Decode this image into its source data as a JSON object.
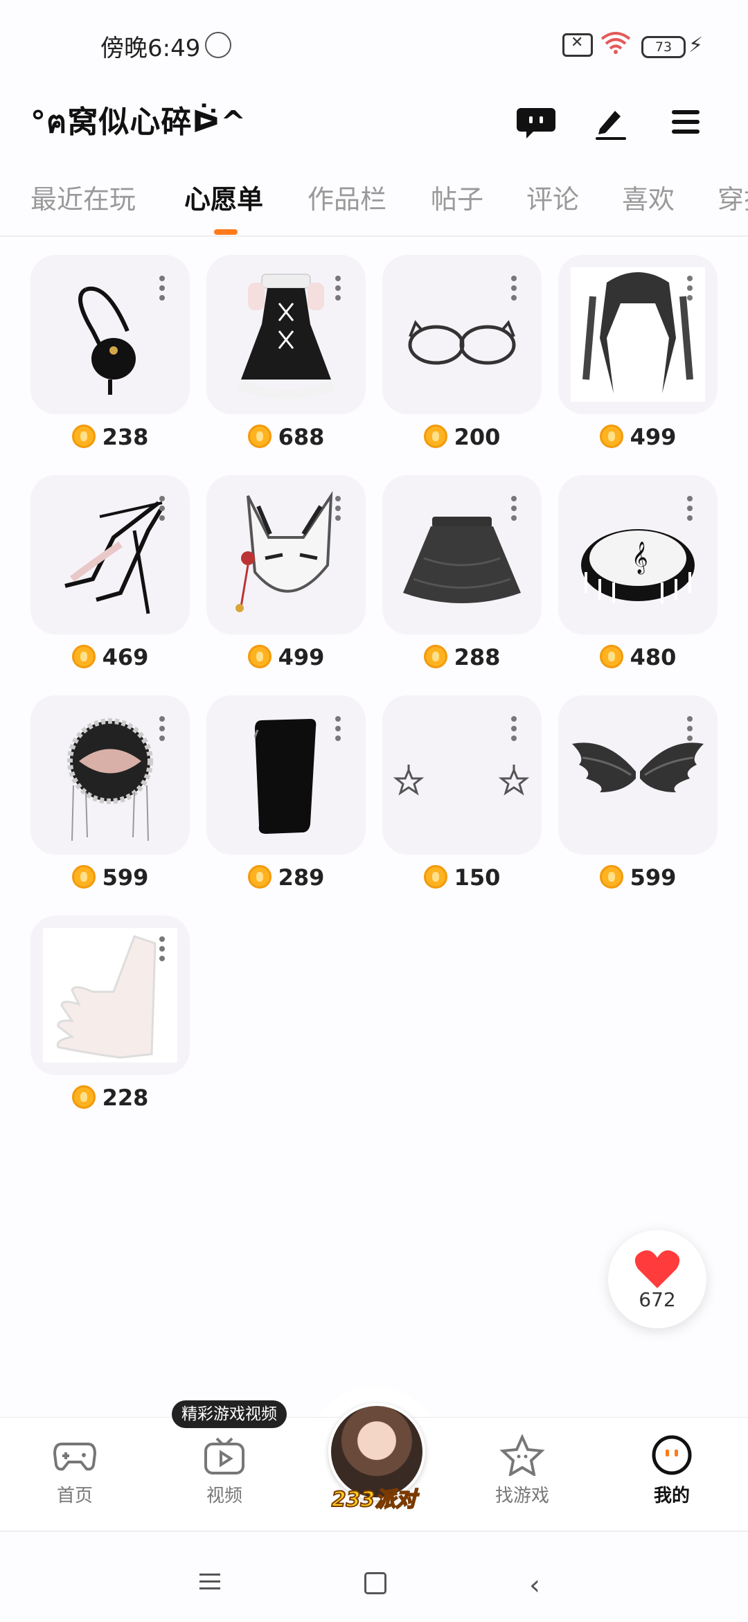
{
  "status": {
    "time": "傍晚6:49",
    "battery": "73"
  },
  "header": {
    "username": "°ฅ窝似心碎ᐖ^"
  },
  "tabs": [
    "最近在玩",
    "心愿单",
    "作品栏",
    "帖子",
    "评论",
    "喜欢",
    "穿搭"
  ],
  "active_tab": "心愿单",
  "items": [
    {
      "name": "shoulder-bag-icon",
      "price": "238"
    },
    {
      "name": "lolita-dress-icon",
      "price": "688"
    },
    {
      "name": "cat-eye-glasses-icon",
      "price": "200"
    },
    {
      "name": "twin-tail-hair-icon",
      "price": "499"
    },
    {
      "name": "stiletto-sandal-icon",
      "price": "469"
    },
    {
      "name": "fox-mask-icon",
      "price": "499"
    },
    {
      "name": "tulle-skirt-icon",
      "price": "288"
    },
    {
      "name": "music-cake-icon",
      "price": "480"
    },
    {
      "name": "lace-accessory-icon",
      "price": "599"
    },
    {
      "name": "phone-prop-icon",
      "price": "289"
    },
    {
      "name": "star-earrings-icon",
      "price": "150"
    },
    {
      "name": "black-wings-icon",
      "price": "599"
    },
    {
      "name": "lace-glove-icon",
      "price": "228"
    }
  ],
  "like": {
    "count": "672"
  },
  "nav": {
    "home": "首页",
    "video": "视频",
    "video_tip": "精彩游戏视频",
    "party": "233派对",
    "find": "找游戏",
    "mine": "我的"
  },
  "colors": {
    "accent": "#ff7a1a",
    "coin": "#ffb21f",
    "heart": "#ff3b3b"
  }
}
